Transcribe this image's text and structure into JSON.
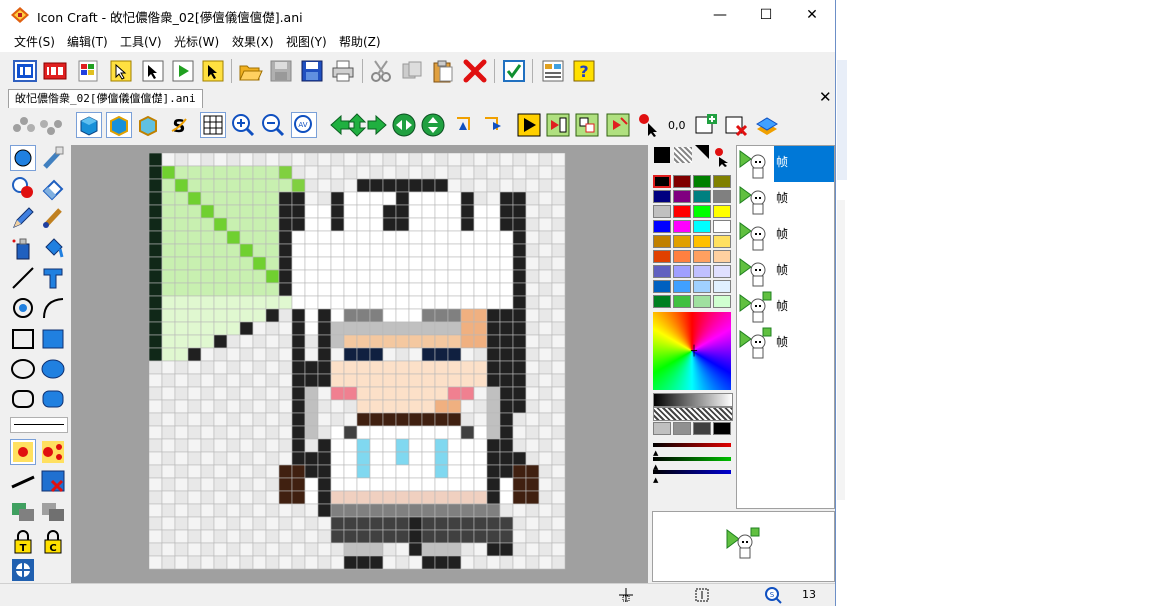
{
  "window": {
    "title": "Icon Craft - 敀忋儂偺衆_02[儚儃儀儃儃儊].ani",
    "minimize_label": "—",
    "maximize_label": "☐",
    "close_label": "✕"
  },
  "menu": [
    {
      "label": "文件(S)"
    },
    {
      "label": "编辑(T)"
    },
    {
      "label": "工具(V)"
    },
    {
      "label": "光标(W)"
    },
    {
      "label": "效果(X)"
    },
    {
      "label": "视图(Y)"
    },
    {
      "label": "帮助(Z)"
    }
  ],
  "document": {
    "tab_label": "敀忋儂偺衆_02[儚儃儀儃儃儊].ani",
    "close_label": "✕"
  },
  "toolbar2": {
    "hotspot_readout": "0,0"
  },
  "frames": {
    "label": "帧",
    "count": 6,
    "selected_index": 0
  },
  "statusbar": {
    "readout": "13"
  },
  "colors": {
    "accent": "#0078d7",
    "canvas_bg": "#a0a0a0",
    "swatches": [
      "#000000",
      "#800000",
      "#008000",
      "#808000",
      "#000080",
      "#800080",
      "#008080",
      "#808080",
      "#c0c0c0",
      "#ff0000",
      "#00ff00",
      "#ffff00",
      "#0000ff",
      "#ff00ff",
      "#00ffff",
      "#ffffff",
      "#c08000",
      "#e0a000",
      "#ffc000",
      "#ffe060",
      "#e04000",
      "#ff8040",
      "#ffa060",
      "#ffd0a0",
      "#6060c0",
      "#a0a0ff",
      "#c0c0ff",
      "#e0e0ff",
      "#0060c0",
      "#40a0ff",
      "#a0d0ff",
      "#e0f0ff",
      "#008020",
      "#40c040",
      "#a0e0a0",
      "#d0ffd0"
    ],
    "gray_swatches": [
      "#c0c0c0",
      "#909090",
      "#404040",
      "#000000"
    ]
  }
}
